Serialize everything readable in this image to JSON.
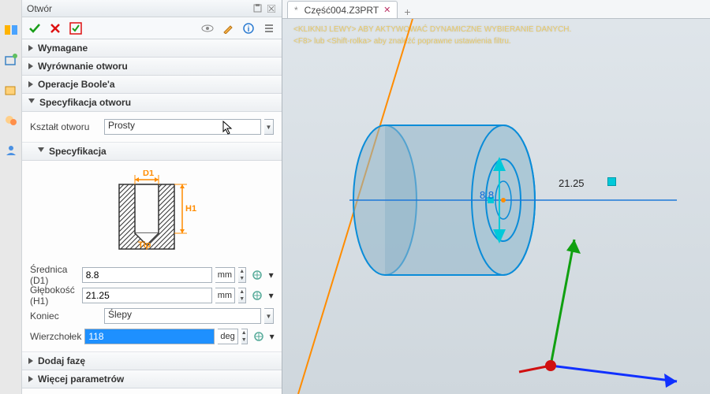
{
  "window": {
    "title": "Otwór"
  },
  "tab": {
    "dirty": "*",
    "name": "Część004.Z3PRT"
  },
  "hints": {
    "line1": "<KLIKNIJ LEWY> ABY AKTYWOWAĆ DYNAMICZNE WYBIERANIE DANYCH.",
    "line2": "<F8> lub <Shift-rolka> aby znaleźć poprawne ustawienia filtru."
  },
  "sections": {
    "required": "Wymagane",
    "alignment": "Wyrównanie otworu",
    "boolean": "Operacje Boole'a",
    "holespec": "Specyfikacja otworu",
    "spec": "Specyfikacja",
    "chamfer": "Dodaj fazę",
    "more": "Więcej parametrów"
  },
  "shape": {
    "label": "Kształt otworu",
    "value": "Prosty"
  },
  "diagram": {
    "d1": "D1",
    "h1": "H1",
    "tip": "Tip"
  },
  "fields": {
    "diameter": {
      "label": "Średnica (D1)",
      "value": "8.8",
      "unit": "mm"
    },
    "depth": {
      "label": "Głębokość (H1)",
      "value": "21.25",
      "unit": "mm"
    },
    "end": {
      "label": "Koniec",
      "value": "Ślepy"
    },
    "tip": {
      "label": "Wierzchołek",
      "value": "118",
      "unit": "deg"
    }
  },
  "viewport": {
    "dim1": "8.8",
    "dim2": "21.25"
  }
}
